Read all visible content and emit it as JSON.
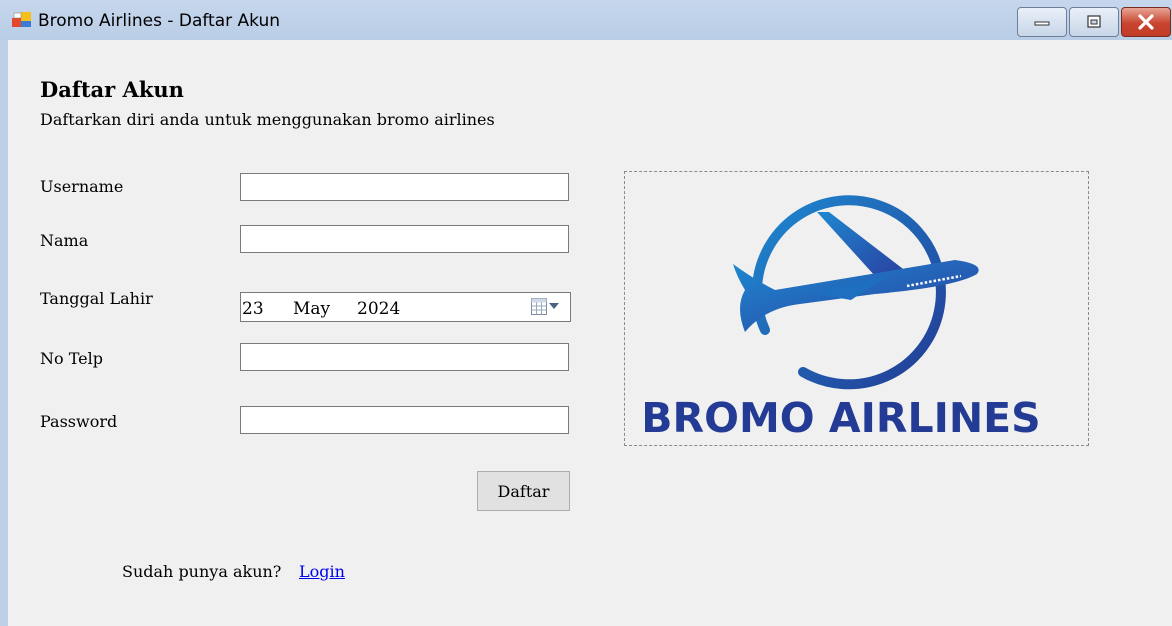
{
  "window": {
    "title": "Bromo Airlines - Daftar Akun",
    "icon": "app-window-icon",
    "controls": [
      "minimize-icon",
      "maximize-icon",
      "close-icon"
    ]
  },
  "form": {
    "heading": "Daftar Akun",
    "subheading": "Daftarkan diri anda untuk menggunakan bromo airlines",
    "fields": {
      "username": {
        "label": "Username",
        "value": ""
      },
      "nama": {
        "label": "Nama",
        "value": ""
      },
      "tanggal_lahir": {
        "label": "Tanggal Lahir",
        "day": "23",
        "month": "May",
        "year": "2024"
      },
      "no_telp": {
        "label": "No Telp",
        "value": ""
      },
      "password": {
        "label": "Password",
        "value": ""
      }
    },
    "submit_label": "Daftar",
    "login_prompt": "Sudah punya akun?",
    "login_link": "Login"
  },
  "logo": {
    "text": "BROMO AIRLINES",
    "colors": {
      "primary": "#233b94",
      "accent": "#1e88d0"
    }
  },
  "colors": {
    "background": "#f0f0f0",
    "titlebar": "#c6d7ec",
    "close_button": "#c8452f",
    "link": "#0000ee"
  }
}
